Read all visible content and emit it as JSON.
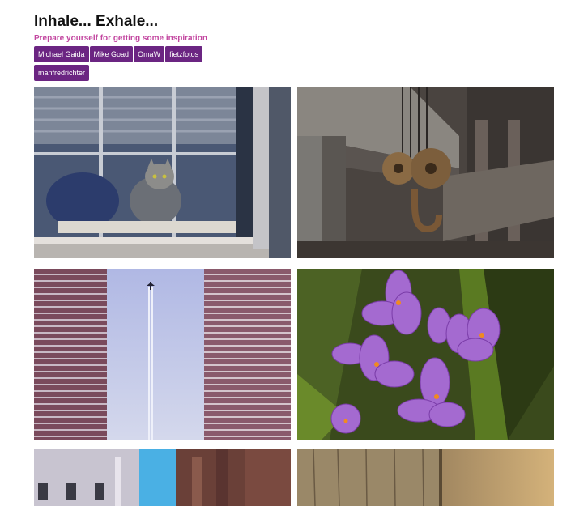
{
  "header": {
    "title": "Inhale... Exhale...",
    "subtitle": "Prepare yourself for getting some inspiration"
  },
  "tags": [
    {
      "label": "Michael Gaida"
    },
    {
      "label": "Mike Goad"
    },
    {
      "label": "OmaW"
    },
    {
      "label": "fietzfotos"
    },
    {
      "label": "manfredrichter"
    }
  ],
  "photos": [
    {
      "subject": "cat-behind-window",
      "dominant_color": "#4a5468"
    },
    {
      "subject": "rusty-crane-hook",
      "dominant_color": "#5a5550"
    },
    {
      "subject": "airplane-between-brick-walls",
      "dominant_color": "#7a5a78"
    },
    {
      "subject": "purple-crocus-flowers",
      "dominant_color": "#9a5cc4"
    },
    {
      "subject": "old-town-street",
      "dominant_color": "#a8a4b0"
    },
    {
      "subject": "wooden-pole",
      "dominant_color": "#a88a5c"
    }
  ]
}
